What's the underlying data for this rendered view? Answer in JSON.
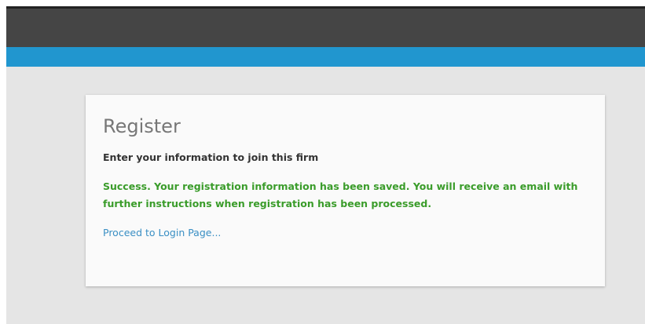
{
  "colors": {
    "header_dark": "#454545",
    "header_accent": "#2196cf",
    "page_background": "#e5e5e5",
    "card_background": "#fafafa",
    "title_text": "#777777",
    "subtitle_text": "#333333",
    "success_text": "#3a9c2a",
    "link_text": "#3a8fc4"
  },
  "card": {
    "title": "Register",
    "subtitle": "Enter your information to join this firm",
    "success_message": "Success. Your registration information has been saved. You will receive an email with further instructions when registration has been processed.",
    "login_link_label": "Proceed to Login Page..."
  }
}
